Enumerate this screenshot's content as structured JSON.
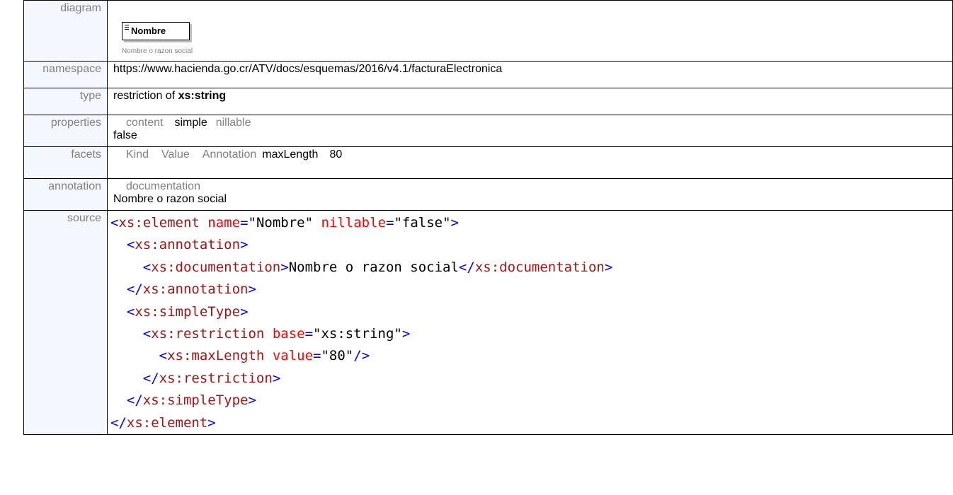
{
  "labels": {
    "diagram": "diagram",
    "namespace": "namespace",
    "type": "type",
    "properties": "properties",
    "facets": "facets",
    "annotation": "annotation",
    "source": "source"
  },
  "diagram": {
    "element_name": "Nombre",
    "documentation": "Nombre o razon social"
  },
  "namespace": "https://www.hacienda.go.cr/ATV/docs/esquemas/2016/v4.1/facturaElectronica",
  "type": {
    "prefix": "restriction of ",
    "base": "xs:string"
  },
  "properties": {
    "content_key": "content",
    "content_value": "simple",
    "nillable_key": "nillable",
    "nillable_value": "false"
  },
  "facets": {
    "kind_header": "Kind",
    "value_header": "Value",
    "annotation_header": "Annotation",
    "kind": "maxLength",
    "value": "80"
  },
  "annotation": {
    "key": "documentation",
    "text": "Nombre o razon social"
  },
  "source": {
    "element_tag": "xs:element",
    "name_attr": "name",
    "name_val": "\"Nombre\"",
    "nillable_attr": "nillable",
    "nillable_val": "\"false\"",
    "annotation_tag": "xs:annotation",
    "documentation_tag": "xs:documentation",
    "documentation_text": "Nombre o razon social",
    "simpletype_tag": "xs:simpleType",
    "restriction_tag": "xs:restriction",
    "base_attr": "base",
    "base_val": "\"xs:string\"",
    "maxlength_tag": "xs:maxLength",
    "value_attr": "value",
    "value_val": "\"80\""
  }
}
